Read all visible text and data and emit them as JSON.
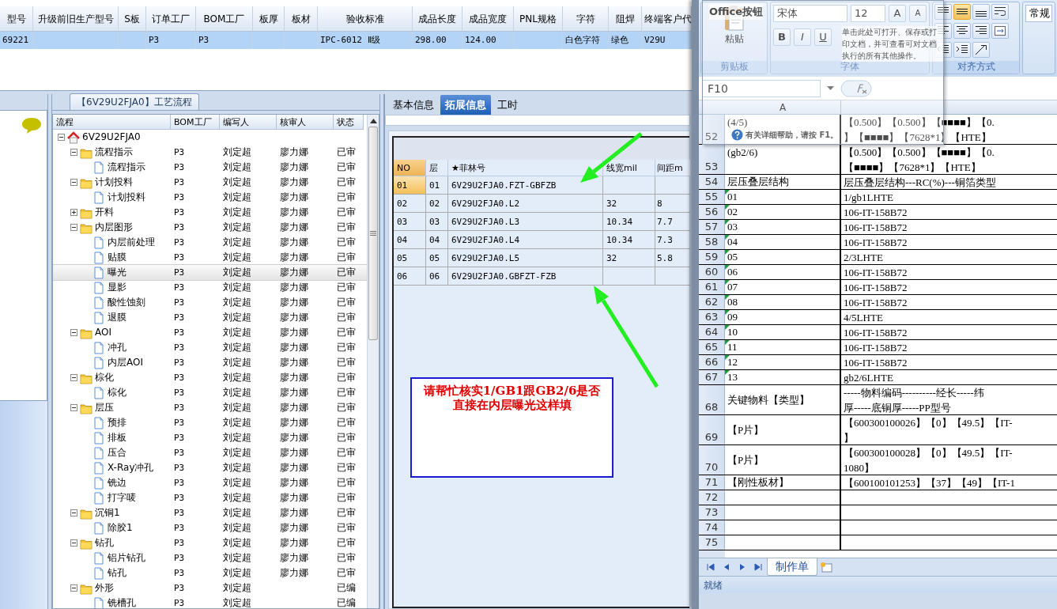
{
  "order_grid": {
    "columns": [
      "型号",
      "升级前旧生产型号",
      "S板",
      "订单工厂",
      "BOM工厂",
      "板厚",
      "板材",
      "验收标准",
      "成品长度",
      "成品宽度",
      "PNL规格",
      "字符",
      "阻焊",
      "终端客户代"
    ],
    "rows": [
      {
        "selected": true,
        "cells": [
          "69221",
          "",
          "",
          "P3",
          "P3",
          "",
          "",
          "IPC-6012 Ⅱ级",
          "298.00",
          "124.00",
          "",
          "白色字符",
          "绿色",
          "V29U"
        ]
      }
    ]
  },
  "process_panel": {
    "title": "【6V29U2FJA0】工艺流程",
    "columns": [
      "流程",
      "BOM工厂",
      "编写人",
      "核审人",
      "状态"
    ],
    "tree": [
      {
        "kind": "root",
        "label": "6V29U2FJA0",
        "expanded": true,
        "selected": false,
        "children": [
          {
            "kind": "folder",
            "label": "流程指示",
            "bom": "P3",
            "writer": "刘定超",
            "reviewer": "廖力娜",
            "status": "已审",
            "expanded": true,
            "selected": false,
            "children": [
              {
                "kind": "doc",
                "label": "流程指示",
                "bom": "P3",
                "writer": "刘定超",
                "reviewer": "廖力娜",
                "status": "已审",
                "selected": false
              }
            ]
          },
          {
            "kind": "folder",
            "label": "计划投料",
            "bom": "P3",
            "writer": "刘定超",
            "reviewer": "廖力娜",
            "status": "已审",
            "expanded": true,
            "selected": false,
            "children": [
              {
                "kind": "doc",
                "label": "计划投料",
                "bom": "P3",
                "writer": "刘定超",
                "reviewer": "廖力娜",
                "status": "已审",
                "selected": false
              }
            ]
          },
          {
            "kind": "folder",
            "label": "开料",
            "bom": "P3",
            "writer": "刘定超",
            "reviewer": "廖力娜",
            "status": "已审",
            "expanded": false,
            "selected": false
          },
          {
            "kind": "folder",
            "label": "内层图形",
            "bom": "P3",
            "writer": "刘定超",
            "reviewer": "廖力娜",
            "status": "已审",
            "expanded": true,
            "selected": false,
            "children": [
              {
                "kind": "doc",
                "label": "内层前处理",
                "bom": "P3",
                "writer": "刘定超",
                "reviewer": "廖力娜",
                "status": "已审",
                "selected": false
              },
              {
                "kind": "doc",
                "label": "贴膜",
                "bom": "P3",
                "writer": "刘定超",
                "reviewer": "廖力娜",
                "status": "已审",
                "selected": false
              },
              {
                "kind": "doc",
                "label": "曝光",
                "bom": "P3",
                "writer": "刘定超",
                "reviewer": "廖力娜",
                "status": "已审",
                "selected": true
              },
              {
                "kind": "doc",
                "label": "显影",
                "bom": "P3",
                "writer": "刘定超",
                "reviewer": "廖力娜",
                "status": "已审",
                "selected": false
              },
              {
                "kind": "doc",
                "label": "酸性蚀刻",
                "bom": "P3",
                "writer": "刘定超",
                "reviewer": "廖力娜",
                "status": "已审",
                "selected": false
              },
              {
                "kind": "doc",
                "label": "退膜",
                "bom": "P3",
                "writer": "刘定超",
                "reviewer": "廖力娜",
                "status": "已审",
                "selected": false
              }
            ]
          },
          {
            "kind": "folder",
            "label": "AOI",
            "bom": "P3",
            "writer": "刘定超",
            "reviewer": "廖力娜",
            "status": "已审",
            "expanded": true,
            "selected": false,
            "children": [
              {
                "kind": "doc",
                "label": "冲孔",
                "bom": "P3",
                "writer": "刘定超",
                "reviewer": "廖力娜",
                "status": "已审",
                "selected": false
              },
              {
                "kind": "doc",
                "label": "内层AOI",
                "bom": "P3",
                "writer": "刘定超",
                "reviewer": "廖力娜",
                "status": "已审",
                "selected": false
              }
            ]
          },
          {
            "kind": "folder",
            "label": "棕化",
            "bom": "P3",
            "writer": "刘定超",
            "reviewer": "廖力娜",
            "status": "已审",
            "expanded": true,
            "selected": false,
            "children": [
              {
                "kind": "doc",
                "label": "棕化",
                "bom": "P3",
                "writer": "刘定超",
                "reviewer": "廖力娜",
                "status": "已审",
                "selected": false
              }
            ]
          },
          {
            "kind": "folder",
            "label": "层压",
            "bom": "P3",
            "writer": "刘定超",
            "reviewer": "廖力娜",
            "status": "已审",
            "expanded": true,
            "selected": false,
            "children": [
              {
                "kind": "doc",
                "label": "预排",
                "bom": "P3",
                "writer": "刘定超",
                "reviewer": "廖力娜",
                "status": "已审",
                "selected": false
              },
              {
                "kind": "doc",
                "label": "排板",
                "bom": "P3",
                "writer": "刘定超",
                "reviewer": "廖力娜",
                "status": "已审",
                "selected": false
              },
              {
                "kind": "doc",
                "label": "压合",
                "bom": "P3",
                "writer": "刘定超",
                "reviewer": "廖力娜",
                "status": "已审",
                "selected": false
              },
              {
                "kind": "doc",
                "label": "X-Ray冲孔",
                "bom": "P3",
                "writer": "刘定超",
                "reviewer": "廖力娜",
                "status": "已审",
                "selected": false
              },
              {
                "kind": "doc",
                "label": "铣边",
                "bom": "P3",
                "writer": "刘定超",
                "reviewer": "廖力娜",
                "status": "已审",
                "selected": false
              },
              {
                "kind": "doc",
                "label": "打字唛",
                "bom": "P3",
                "writer": "刘定超",
                "reviewer": "廖力娜",
                "status": "已审",
                "selected": false
              }
            ]
          },
          {
            "kind": "folder",
            "label": "沉铜1",
            "bom": "P3",
            "writer": "刘定超",
            "reviewer": "廖力娜",
            "status": "已审",
            "expanded": true,
            "selected": false,
            "children": [
              {
                "kind": "doc",
                "label": "除胶1",
                "bom": "P3",
                "writer": "刘定超",
                "reviewer": "廖力娜",
                "status": "已审",
                "selected": false
              }
            ]
          },
          {
            "kind": "folder",
            "label": "钻孔",
            "bom": "P3",
            "writer": "刘定超",
            "reviewer": "廖力娜",
            "status": "已审",
            "expanded": true,
            "selected": false,
            "children": [
              {
                "kind": "doc",
                "label": "铝片钻孔",
                "bom": "P3",
                "writer": "刘定超",
                "reviewer": "廖力娜",
                "status": "已审",
                "selected": false
              },
              {
                "kind": "doc",
                "label": "钻孔",
                "bom": "P3",
                "writer": "刘定超",
                "reviewer": "廖力娜",
                "status": "已审",
                "selected": false
              }
            ]
          },
          {
            "kind": "folder",
            "label": "外形",
            "bom": "P3",
            "writer": "刘定超",
            "status": "已编",
            "expanded": true,
            "selected": false,
            "children": [
              {
                "kind": "doc",
                "label": "铣槽孔",
                "bom": "P3",
                "writer": "刘定超",
                "status": "已编",
                "selected": false
              }
            ]
          }
        ]
      }
    ]
  },
  "detail_panel": {
    "tabs": [
      {
        "label": "基本信息",
        "selected": false
      },
      {
        "label": "拓展信息",
        "selected": true
      },
      {
        "label": "工时",
        "selected": false
      }
    ],
    "columns": [
      "NO",
      "层",
      "★菲林号",
      "线宽mil",
      "间距m"
    ],
    "rows": [
      {
        "selected": true,
        "cells": [
          "01",
          "01",
          "6V29U2FJA0.FZT-GBFZB",
          "",
          ""
        ]
      },
      {
        "selected": false,
        "cells": [
          "02",
          "02",
          "6V29U2FJA0.L2",
          "32",
          "8"
        ]
      },
      {
        "selected": false,
        "cells": [
          "03",
          "03",
          "6V29U2FJA0.L3",
          "10.34",
          "7.7"
        ]
      },
      {
        "selected": false,
        "cells": [
          "04",
          "04",
          "6V29U2FJA0.L4",
          "10.34",
          "7.3"
        ]
      },
      {
        "selected": false,
        "cells": [
          "05",
          "05",
          "6V29U2FJA0.L5",
          "32",
          "5.8"
        ]
      },
      {
        "selected": false,
        "cells": [
          "06",
          "06",
          "6V29U2FJA0.GBFZT-FZB",
          "",
          ""
        ]
      }
    ]
  },
  "annotation": {
    "text": "请帮忙核实1/GB1跟GB2/6是否直接在内层曝光这样填"
  },
  "excel": {
    "ribbon": {
      "groups": [
        {
          "kind": "clipboard",
          "label": "剪贴板",
          "paste": "粘贴"
        },
        {
          "kind": "font",
          "label": "字体",
          "font": "宋体",
          "size": "12",
          "grow": "A",
          "shrink": "A",
          "styles": [
            "B",
            "I",
            "U"
          ]
        },
        {
          "kind": "align",
          "label": "对齐方式",
          "buttons": [
            {
              "kind": "top",
              "selected": false
            },
            {
              "kind": "middle",
              "selected": true
            },
            {
              "kind": "bottom",
              "selected": false
            },
            {
              "kind": "wrap",
              "selected": false
            },
            {
              "kind": "left",
              "selected": false
            },
            {
              "kind": "center",
              "selected": false
            },
            {
              "kind": "right",
              "selected": false
            },
            {
              "kind": "merge",
              "selected": false
            },
            {
              "kind": "outdent",
              "selected": false
            },
            {
              "kind": "indent",
              "selected": false
            },
            {
              "kind": "orient",
              "selected": false
            }
          ]
        },
        {
          "kind": "number",
          "format": "常规"
        }
      ]
    },
    "tooltip": {
      "title": "Office按钮",
      "text": "单击此处可打开、保存或打印文档，并可查看可对文档执行的所有其他操作。",
      "help": "有关详细帮助，请按 F1。"
    },
    "name_box": "F10",
    "columns": [
      "A"
    ],
    "rows": [
      {
        "num": "52",
        "a": "(4/5)",
        "b": [
          "【0.500】【0.500】【■■■■】【0.",
          "】【■■■■】【7628*1】【HTE】"
        ],
        "flag": false
      },
      {
        "num": "53",
        "a": "(gb2/6)",
        "b": [
          "【0.500】【0.500】【■■■■】【0.",
          "【■■■■】【7628*1】【HTE】"
        ],
        "flag": false
      },
      {
        "num": "54",
        "a": "层压叠层结构",
        "b": [
          "层压叠层结构---RC(%)---铜箔类型"
        ],
        "flag": false
      },
      {
        "num": "55",
        "a": "01",
        "b": [
          "1/gb1LHTE"
        ],
        "flag": true
      },
      {
        "num": "56",
        "a": "02",
        "b": [
          "106-IT-158B72"
        ],
        "flag": true
      },
      {
        "num": "57",
        "a": "03",
        "b": [
          "106-IT-158B72"
        ],
        "flag": true
      },
      {
        "num": "58",
        "a": "04",
        "b": [
          "106-IT-158B72"
        ],
        "flag": true
      },
      {
        "num": "59",
        "a": "05",
        "b": [
          "2/3LHTE"
        ],
        "flag": true
      },
      {
        "num": "60",
        "a": "06",
        "b": [
          "106-IT-158B72"
        ],
        "flag": true
      },
      {
        "num": "61",
        "a": "07",
        "b": [
          "106-IT-158B72"
        ],
        "flag": true
      },
      {
        "num": "62",
        "a": "08",
        "b": [
          "106-IT-158B72"
        ],
        "flag": true
      },
      {
        "num": "63",
        "a": "09",
        "b": [
          "4/5LHTE"
        ],
        "flag": true
      },
      {
        "num": "64",
        "a": "10",
        "b": [
          "106-IT-158B72"
        ],
        "flag": true
      },
      {
        "num": "65",
        "a": "11",
        "b": [
          "106-IT-158B72"
        ],
        "flag": true
      },
      {
        "num": "66",
        "a": "12",
        "b": [
          "106-IT-158B72"
        ],
        "flag": true
      },
      {
        "num": "67",
        "a": "13",
        "b": [
          "gb2/6LHTE"
        ],
        "flag": true
      },
      {
        "num": "68",
        "a": "关键物料【类型】",
        "b": [
          "-----物料编码----------经长-----纬",
          "厚-----底铜厚-----PP型号"
        ],
        "flag": false
      },
      {
        "num": "69",
        "a": "【P片】",
        "b": [
          "【600300100026】【0】【49.5】【IT-",
          "】"
        ],
        "flag": false
      },
      {
        "num": "70",
        "a": "【P片】",
        "b": [
          "【600300100028】【0】【49.5】【IT-",
          "1080】"
        ],
        "flag": false
      },
      {
        "num": "71",
        "a": "【刚性板材】",
        "b": [
          "【600100101253】【37】【49】【IT-1"
        ],
        "flag": false
      },
      {
        "num": "72",
        "flag": false
      },
      {
        "num": "73",
        "flag": false
      },
      {
        "num": "74",
        "flag": false
      },
      {
        "num": "75",
        "flag": false
      }
    ],
    "sheet_tabs": [
      {
        "label": "制作单",
        "selected": true
      }
    ],
    "status": "就绪"
  }
}
